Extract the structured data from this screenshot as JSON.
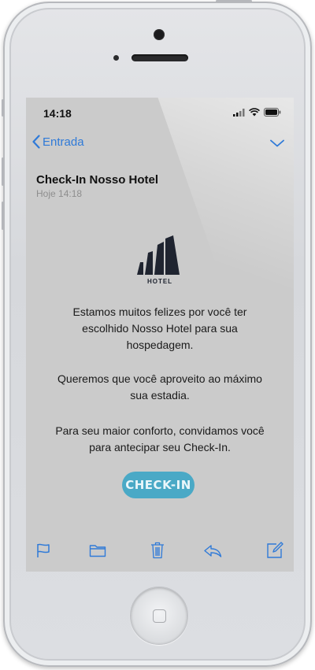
{
  "status": {
    "time": "14:18"
  },
  "nav": {
    "back_label": "Entrada"
  },
  "email": {
    "subject": "Check-In Nosso Hotel",
    "date": "Hoje 14:18",
    "logo_text": "HOTEL",
    "paragraphs": [
      [
        "Estamos muitos felizes por você ter",
        "escolhido Nosso Hotel para sua",
        "hospedagem."
      ],
      [
        "Queremos que você aproveito ao máximo",
        "sua estadia."
      ],
      [
        "Para seu maior conforto, convidamos você",
        "para antecipar seu Check-In."
      ]
    ],
    "cta_label": "CHECK-IN"
  },
  "toolbar": {
    "icons": [
      "flag-icon",
      "folder-icon",
      "trash-icon",
      "reply-icon",
      "compose-icon"
    ]
  },
  "colors": {
    "accent": "#2f7ad8",
    "cta": "#4aa9c6",
    "screen_bg": "#cbcbcb"
  }
}
